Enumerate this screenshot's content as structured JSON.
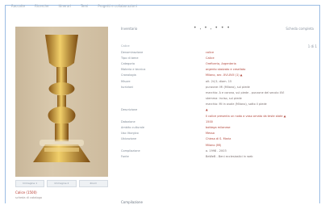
{
  "nav": [
    "Raccolte",
    "Ricerche",
    "Itinerari",
    "Temi",
    "Progetti e collaborazioni"
  ],
  "header": {
    "inventory_label": "Inventario",
    "dots": "• , • , • • •",
    "right_top": "Scheda completa",
    "left_line": "Calice",
    "right_line": "1 di 1"
  },
  "details": [
    {
      "key": "Denominazione",
      "value": "calice",
      "dark": false,
      "mark": false
    },
    {
      "key": "Tipo di bene",
      "value": "Calice",
      "dark": false,
      "mark": false
    },
    {
      "key": "Categoria",
      "value": "Oreficeria, Argenteria",
      "dark": false,
      "mark": false
    },
    {
      "key": "Materia e tecnica",
      "value": "argento sbalzato e cesellato",
      "dark": false,
      "mark": false
    },
    {
      "key": "Cronologia",
      "value": "Milano, sec. XVI-XVII (1) ▲",
      "dark": false,
      "mark": true
    },
    {
      "key": "Misure",
      "value": "alt. 24,5; diam. 15",
      "dark": true,
      "mark": false
    },
    {
      "key": "Iscrizioni",
      "value": "punzone: MI (Milano), sul piede",
      "dark": true,
      "mark": false
    },
    {
      "key": "",
      "value": "marchio: A e corona, sul piede - punzone del secolo XVI",
      "dark": true,
      "mark": false
    },
    {
      "key": "",
      "value": "stemma: inciso, sul piede",
      "dark": true,
      "mark": false
    },
    {
      "key": "",
      "value": "marchio: MI in ovale (Milano), sotto il piede",
      "dark": true,
      "mark": false
    },
    {
      "key": "Descrizione",
      "value": "▲",
      "dark": false,
      "mark": true
    },
    {
      "key": "",
      "value": "Il calice presenta un nodo a vaso ornato da teste alate ▲",
      "dark": false,
      "mark": true
    },
    {
      "key": "Datazione",
      "value": "1500",
      "dark": false,
      "mark": false
    },
    {
      "key": "Ambito culturale",
      "value": "bottega milanese",
      "dark": false,
      "mark": false
    },
    {
      "key": "Uso liturgico",
      "value": "Messa",
      "dark": false,
      "mark": false
    },
    {
      "key": "Ubicazione",
      "value": "Chiesa di S. Maria",
      "dark": false,
      "mark": false
    },
    {
      "key": "",
      "value": "Milano (MI)",
      "dark": false,
      "mark": false
    },
    {
      "key": "Compilazione",
      "value": "a. 1998 - 2003",
      "dark": true,
      "mark": false
    },
    {
      "key": "Fonte",
      "value": "BeWeB - Beni ecclesiastici in web",
      "dark": true,
      "mark": false
    }
  ],
  "thumbs": [
    "Immagine 1",
    "Immagine 2",
    "Zoom"
  ],
  "bottom": {
    "link": "Calice (1500)",
    "sub": "scheda di catalogo"
  },
  "footer_label": "Compilazione"
}
